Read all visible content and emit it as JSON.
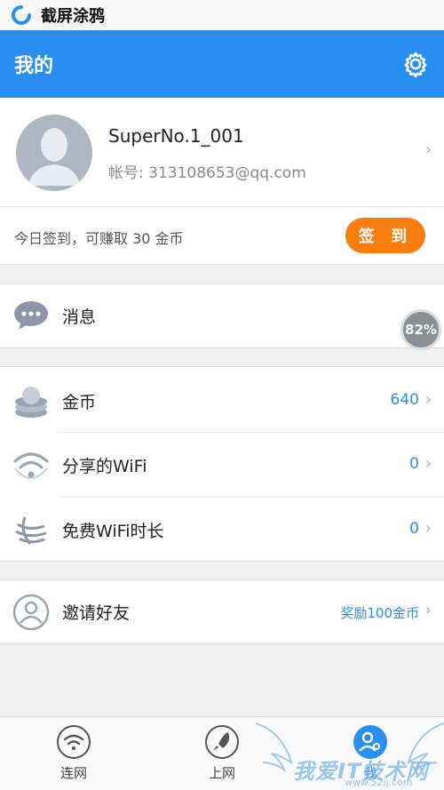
{
  "status_bar": {
    "app_title": "截屏涂鸦"
  },
  "header": {
    "title": "我的"
  },
  "profile": {
    "username": "SuperNo.1_001",
    "account": "帐号: 313108653@qq.com"
  },
  "checkin": {
    "text": "今日签到，可赚取 30 金币",
    "button_label": "签 到"
  },
  "messages": {
    "label": "消息"
  },
  "floating_badge": {
    "text": "82%",
    "value": 82
  },
  "stats": {
    "coins": {
      "label": "金币",
      "value": "640"
    },
    "shared_wifi": {
      "label": "分享的WiFi",
      "value": "0"
    },
    "free_wifi_time": {
      "label": "免费WiFi时长",
      "value": "0"
    }
  },
  "invite": {
    "label": "邀请好友",
    "value": "奖励100金币"
  },
  "tabbar": {
    "tabs": [
      {
        "label": "连网"
      },
      {
        "label": "上网"
      },
      {
        "label": "我"
      }
    ]
  },
  "watermark": {
    "text": "我爱IT技术网",
    "sub": "www.52ij.com"
  },
  "colors": {
    "primary": "#2a8ef1",
    "accent": "#fb7d0e",
    "background": "#f0f0f0"
  }
}
